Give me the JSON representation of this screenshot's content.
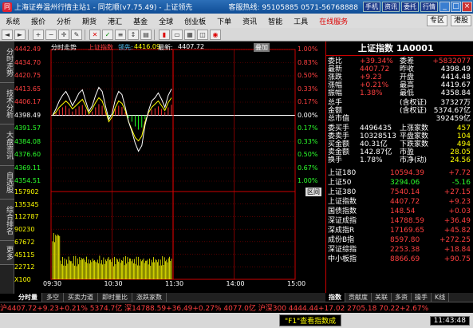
{
  "window": {
    "title": "上海证券温州行情主站1 - 同花顺(v7.75.49) - 上证领先",
    "hotline": "客服热线: 95105885 0571-56768888",
    "top_buttons": [
      "手机",
      "资讯",
      "委托",
      "行情"
    ],
    "win_buttons": [
      "_",
      "□",
      "×"
    ]
  },
  "menu": {
    "items": [
      "系统",
      "报价",
      "分析",
      "期货",
      "港汇",
      "基金",
      "全球",
      "创业板",
      "下单",
      "资讯",
      "智能",
      "工具"
    ],
    "online": "在线服务",
    "zone": "专区",
    "port": "港股"
  },
  "toolbar": {
    "icons": [
      "back",
      "forward",
      "zoom-in",
      "zoom-out",
      "cross",
      "drawing",
      "check",
      "red-x",
      "list",
      "sort",
      "print",
      "bar-chart",
      "monitor",
      "grid",
      "tile",
      "alarm"
    ]
  },
  "left_tabs": [
    "分时走势",
    "技术分析",
    "大盘资讯",
    "自选股",
    "综合排名",
    "更多"
  ],
  "chart": {
    "header": "分时走势",
    "tab": "上证指数",
    "lead_label": "领先:",
    "lead_value": "4416.09",
    "latest_label": "最新:",
    "latest_value": "4407.72",
    "options_label": "叠加",
    "zone_label": "区间",
    "price_ticks": [
      "4442.49",
      "4434.70",
      "4420.75",
      "4413.65",
      "4406.17",
      "4398.49",
      "4391.57",
      "4384.08",
      "4376.60",
      "4369.11",
      "4354.51"
    ],
    "pct_ticks": [
      "1.00%",
      "0.83%",
      "0.50%",
      "0.33%",
      "0.17%",
      "0.00%",
      "0.17%",
      "0.33%",
      "0.50%",
      "0.67%",
      "1.00%"
    ],
    "vol_ticks": [
      "157902",
      "135345",
      "112787",
      "90230",
      "67672",
      "45115",
      "22712",
      "X100"
    ],
    "time_ticks": [
      "09:30",
      "10:30",
      "11:30",
      "14:00",
      "15:00"
    ]
  },
  "quote": {
    "title": "上证指数 1A0001",
    "rows": [
      {
        "l": "委比",
        "v": "+39.34%",
        "l2": "委差",
        "v2": "+5832077"
      },
      {
        "l": "最新",
        "v": "4407.72",
        "l2": "昨收",
        "v2": "4398.49"
      },
      {
        "l": "涨跌",
        "v": "+9.23",
        "l2": "开盘",
        "v2": "4414.48"
      },
      {
        "l": "涨幅",
        "v": "+0.21%",
        "l2": "最高",
        "v2": "4419.67"
      },
      {
        "l": "振幅",
        "v": "1.38%",
        "l2": "最低",
        "v2": "4358.84"
      },
      {
        "l": "总手",
        "v": "",
        "l2": "(含权证)",
        "v2": "37327万"
      },
      {
        "l": "金额",
        "v": "",
        "l2": "(含权证)",
        "v2": "5374.67亿"
      },
      {
        "l": "总市值",
        "v": "",
        "l2": "",
        "v2": "392459亿"
      },
      {
        "l": "委买手",
        "v": "4496435",
        "l2": "上涨家数",
        "v2": "457"
      },
      {
        "l": "委卖手",
        "v": "10328513",
        "l2": "平盘家数",
        "v2": "104"
      },
      {
        "l": "买金额",
        "v": "40.31亿",
        "l2": "下跌家数",
        "v2": "494"
      },
      {
        "l": "卖金额",
        "v": "142.87亿",
        "l2": "市盈",
        "v2": "28.05"
      },
      {
        "l": "换手",
        "v": "1.78%",
        "l2": "市净(动)",
        "v2": "24.56"
      }
    ],
    "indices": [
      {
        "n": "上证180",
        "v": "10594.39",
        "c": "+7.72"
      },
      {
        "n": "上证50",
        "v": "3294.06",
        "c": "-5.16"
      },
      {
        "n": "上证380",
        "v": "7540.14",
        "c": "+27.15"
      },
      {
        "n": "上证指数",
        "v": "4407.72",
        "c": "+9.23"
      },
      {
        "n": "国债指数",
        "v": "148.54",
        "c": "+0.03"
      },
      {
        "n": "深证成指",
        "v": "14788.59",
        "c": "+36.49"
      },
      {
        "n": "深成指R",
        "v": "17169.65",
        "c": "+45.82"
      },
      {
        "n": "成份B指",
        "v": "8597.80",
        "c": "+272.25"
      },
      {
        "n": "深证综指",
        "v": "2253.38",
        "c": "+18.84"
      },
      {
        "n": "中小板指",
        "v": "8866.69",
        "c": "+90.75"
      }
    ]
  },
  "bottom_tabs": [
    "分时量",
    "多空",
    "买卖力道",
    "即时量比",
    "涨跌家数"
  ],
  "right_tabs": [
    "指数",
    "贡献度",
    "关联",
    "多资",
    "操手",
    "K线"
  ],
  "ticker": "沪4407.72+9.23+0.21% 5374.7亿 深14788.59+36.49+0.27% 4077.0亿 沪深300 4444.44+17.02 2705.18 70.22+2.67%",
  "status": {
    "f1": "\"F1\"查看指数成",
    "clock": "11:43:48"
  }
}
